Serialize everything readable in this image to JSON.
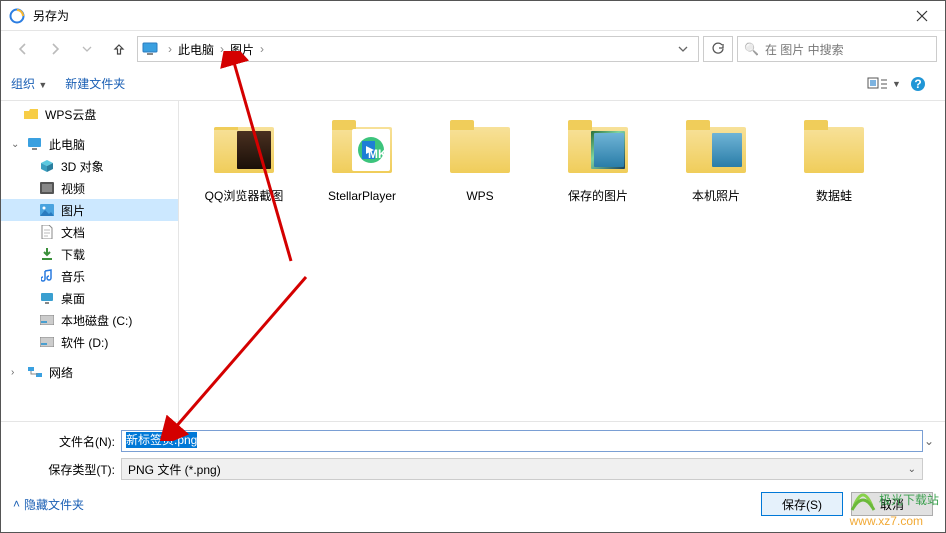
{
  "title": "另存为",
  "breadcrumb": {
    "root": "此电脑",
    "child": "图片"
  },
  "search_placeholder": "在 图片 中搜索",
  "search_icon_glyph": "🔍",
  "toolbar": {
    "organize": "组织",
    "new_folder": "新建文件夹"
  },
  "sidebar": {
    "wps": "WPS云盘",
    "this_pc": "此电脑",
    "objects3d": "3D 对象",
    "videos": "视频",
    "pictures": "图片",
    "documents": "文档",
    "downloads": "下载",
    "music": "音乐",
    "desktop": "桌面",
    "drive_c": "本地磁盘 (C:)",
    "drive_d": "软件 (D:)",
    "network": "网络"
  },
  "files": [
    {
      "name": "QQ浏览器截图",
      "type": "folder-pic"
    },
    {
      "name": "StellarPlayer",
      "type": "folder-app"
    },
    {
      "name": "WPS",
      "type": "folder"
    },
    {
      "name": "保存的图片",
      "type": "folder-pic"
    },
    {
      "name": "本机照片",
      "type": "folder-pic"
    },
    {
      "name": "数据蛙",
      "type": "folder"
    }
  ],
  "filename_label": "文件名(N):",
  "filename_value": "新标签页.png",
  "filetype_label": "保存类型(T):",
  "filetype_value": "PNG 文件 (*.png)",
  "hide_folders": "隐藏文件夹",
  "buttons": {
    "save": "保存(S)",
    "cancel": "取消"
  },
  "watermark": {
    "cn": "极光下载站",
    "url": "www.xz7.com"
  }
}
